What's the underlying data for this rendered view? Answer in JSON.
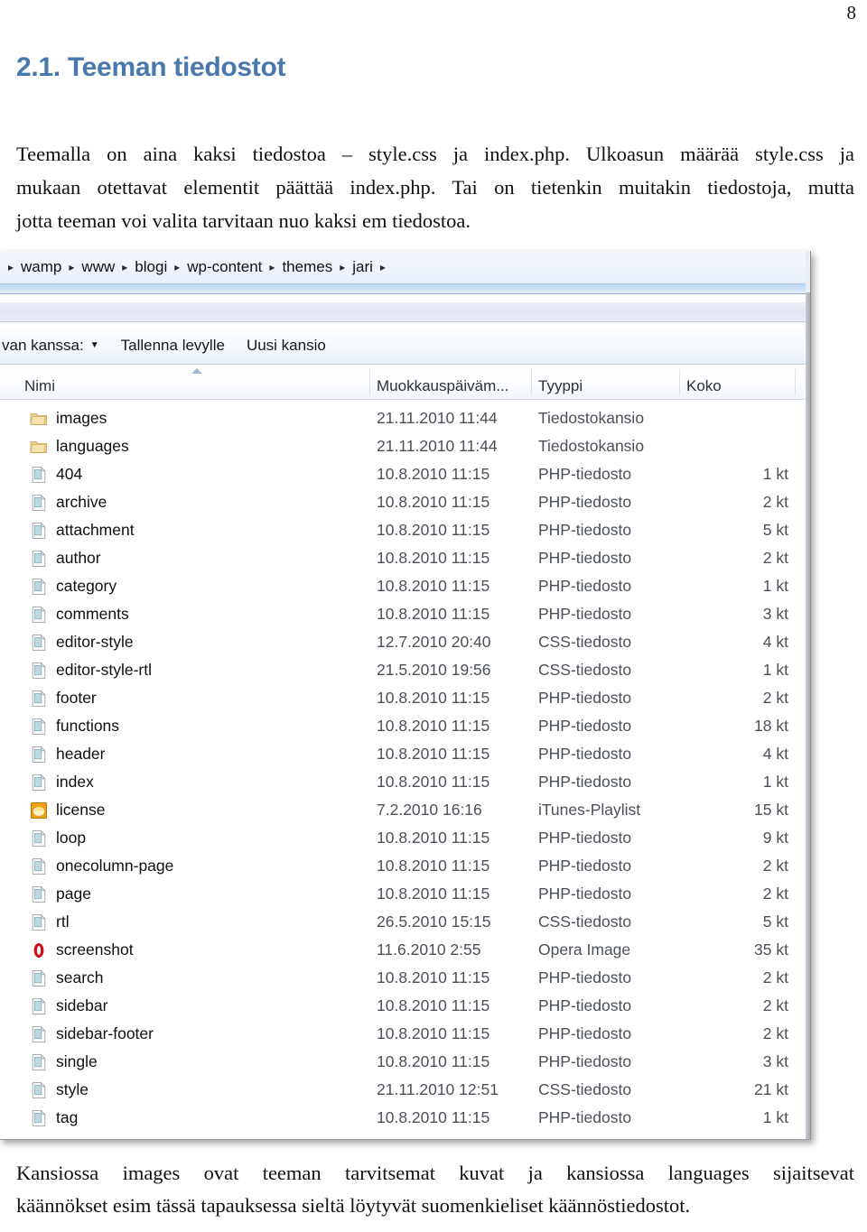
{
  "document": {
    "page_number": "8",
    "heading": "2.1. Teeman tiedostot",
    "intro_lines": [
      "Teemalla on aina kaksi tiedostoa – style.css ja index.php. Ulkoasun määrää style.css ja",
      "mukaan otettavat elementit päättää index.php. Tai on tietenkin muitakin tiedostoja, mutta",
      "jotta teeman voi valita tarvitaan nuo kaksi em tiedostoa."
    ],
    "outro_lines": [
      "Kansiossa images ovat teeman tarvitsemat kuvat ja kansiossa languages sijaitsevat",
      "käännökset esim tässä tapauksessa sieltä löytyvät suomenkieliset käännöstiedostot."
    ]
  },
  "explorer": {
    "breadcrumb": {
      "leading_separator": "▸",
      "items": [
        "wamp",
        "www",
        "blogi",
        "wp-content",
        "themes",
        "jari"
      ],
      "separator": "▸",
      "trailing_separator": "▸"
    },
    "toolbar": {
      "share_label": "van kanssa:",
      "share_caret": "▼",
      "burn_label": "Tallenna levylle",
      "newfolder_label": "Uusi kansio"
    },
    "columns": {
      "name": "Nimi",
      "modified": "Muokkauspäiväm...",
      "type": "Tyyppi",
      "size": "Koko"
    },
    "rows": [
      {
        "icon": "folder-icon",
        "name": "images",
        "modified": "21.11.2010 11:44",
        "type": "Tiedostokansio",
        "size": ""
      },
      {
        "icon": "folder-icon",
        "name": "languages",
        "modified": "21.11.2010 11:44",
        "type": "Tiedostokansio",
        "size": ""
      },
      {
        "icon": "php-file-icon",
        "name": "404",
        "modified": "10.8.2010 11:15",
        "type": "PHP-tiedosto",
        "size": "1 kt"
      },
      {
        "icon": "php-file-icon",
        "name": "archive",
        "modified": "10.8.2010 11:15",
        "type": "PHP-tiedosto",
        "size": "2 kt"
      },
      {
        "icon": "php-file-icon",
        "name": "attachment",
        "modified": "10.8.2010 11:15",
        "type": "PHP-tiedosto",
        "size": "5 kt"
      },
      {
        "icon": "php-file-icon",
        "name": "author",
        "modified": "10.8.2010 11:15",
        "type": "PHP-tiedosto",
        "size": "2 kt"
      },
      {
        "icon": "php-file-icon",
        "name": "category",
        "modified": "10.8.2010 11:15",
        "type": "PHP-tiedosto",
        "size": "1 kt"
      },
      {
        "icon": "php-file-icon",
        "name": "comments",
        "modified": "10.8.2010 11:15",
        "type": "PHP-tiedosto",
        "size": "3 kt"
      },
      {
        "icon": "css-file-icon",
        "name": "editor-style",
        "modified": "12.7.2010 20:40",
        "type": "CSS-tiedosto",
        "size": "4 kt"
      },
      {
        "icon": "css-file-icon",
        "name": "editor-style-rtl",
        "modified": "21.5.2010 19:56",
        "type": "CSS-tiedosto",
        "size": "1 kt"
      },
      {
        "icon": "php-file-icon",
        "name": "footer",
        "modified": "10.8.2010 11:15",
        "type": "PHP-tiedosto",
        "size": "2 kt"
      },
      {
        "icon": "php-file-icon",
        "name": "functions",
        "modified": "10.8.2010 11:15",
        "type": "PHP-tiedosto",
        "size": "18 kt"
      },
      {
        "icon": "php-file-icon",
        "name": "header",
        "modified": "10.8.2010 11:15",
        "type": "PHP-tiedosto",
        "size": "4 kt"
      },
      {
        "icon": "php-file-icon",
        "name": "index",
        "modified": "10.8.2010 11:15",
        "type": "PHP-tiedosto",
        "size": "1 kt"
      },
      {
        "icon": "itunes-playlist-icon",
        "name": "license",
        "modified": "7.2.2010 16:16",
        "type": "iTunes-Playlist",
        "size": "15 kt"
      },
      {
        "icon": "php-file-icon",
        "name": "loop",
        "modified": "10.8.2010 11:15",
        "type": "PHP-tiedosto",
        "size": "9 kt"
      },
      {
        "icon": "php-file-icon",
        "name": "onecolumn-page",
        "modified": "10.8.2010 11:15",
        "type": "PHP-tiedosto",
        "size": "2 kt"
      },
      {
        "icon": "php-file-icon",
        "name": "page",
        "modified": "10.8.2010 11:15",
        "type": "PHP-tiedosto",
        "size": "2 kt"
      },
      {
        "icon": "css-file-icon",
        "name": "rtl",
        "modified": "26.5.2010 15:15",
        "type": "CSS-tiedosto",
        "size": "5 kt"
      },
      {
        "icon": "opera-image-icon",
        "name": "screenshot",
        "modified": "11.6.2010 2:55",
        "type": "Opera Image",
        "size": "35 kt"
      },
      {
        "icon": "php-file-icon",
        "name": "search",
        "modified": "10.8.2010 11:15",
        "type": "PHP-tiedosto",
        "size": "2 kt"
      },
      {
        "icon": "php-file-icon",
        "name": "sidebar",
        "modified": "10.8.2010 11:15",
        "type": "PHP-tiedosto",
        "size": "2 kt"
      },
      {
        "icon": "php-file-icon",
        "name": "sidebar-footer",
        "modified": "10.8.2010 11:15",
        "type": "PHP-tiedosto",
        "size": "2 kt"
      },
      {
        "icon": "php-file-icon",
        "name": "single",
        "modified": "10.8.2010 11:15",
        "type": "PHP-tiedosto",
        "size": "3 kt"
      },
      {
        "icon": "css-file-icon",
        "name": "style",
        "modified": "21.11.2010 12:51",
        "type": "CSS-tiedosto",
        "size": "21 kt"
      },
      {
        "icon": "php-file-icon",
        "name": "tag",
        "modified": "10.8.2010 11:15",
        "type": "PHP-tiedosto",
        "size": "1 kt"
      }
    ]
  },
  "colors": {
    "heading": "#4878ad",
    "folder": "#f0cf84",
    "file": "#bcd9e0",
    "itunes": "#f0a018",
    "opera": "#cc0f16"
  }
}
